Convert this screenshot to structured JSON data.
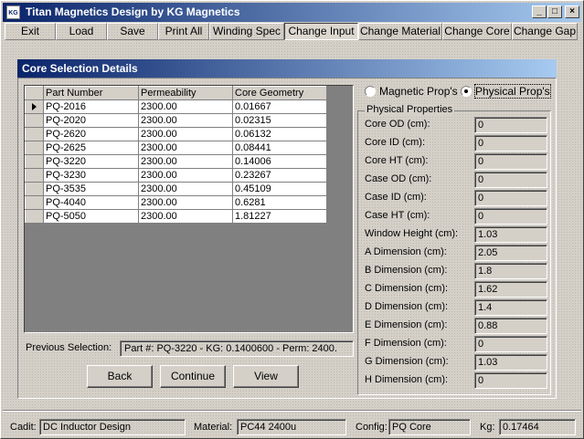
{
  "window": {
    "title": "Titan Magnetics Design by KG Magnetics",
    "icon_label": "KG",
    "minimize": "_",
    "maximize": "□",
    "close": "×"
  },
  "menu": [
    "Exit",
    "Load",
    "Save",
    "Print All",
    "Winding Spec",
    "Change Input",
    "Change Material",
    "Change Core",
    "Change Gap"
  ],
  "panel": {
    "title": "Core Selection Details"
  },
  "grid": {
    "columns": [
      "Part Number",
      "Permeability",
      "Core Geometry"
    ],
    "rows": [
      [
        "PQ-2016",
        "2300.00",
        "0.01667"
      ],
      [
        "PQ-2020",
        "2300.00",
        "0.02315"
      ],
      [
        "PQ-2620",
        "2300.00",
        "0.06132"
      ],
      [
        "PQ-2625",
        "2300.00",
        "0.08441"
      ],
      [
        "PQ-3220",
        "2300.00",
        "0.14006"
      ],
      [
        "PQ-3230",
        "2300.00",
        "0.23267"
      ],
      [
        "PQ-3535",
        "2300.00",
        "0.45109"
      ],
      [
        "PQ-4040",
        "2300.00",
        "0.6281"
      ],
      [
        "PQ-5050",
        "2300.00",
        "1.81227"
      ]
    ]
  },
  "props_mode": {
    "magnetic_label": "Magnetic Prop's",
    "physical_label": "Physical Prop's",
    "selected": "physical"
  },
  "physical": {
    "legend": "Physical Properties",
    "rows": [
      {
        "label": "Core OD (cm):",
        "value": "0"
      },
      {
        "label": "Core ID (cm):",
        "value": "0"
      },
      {
        "label": "Core HT (cm):",
        "value": "0"
      },
      {
        "label": "Case OD (cm):",
        "value": "0"
      },
      {
        "label": "Case ID (cm):",
        "value": "0"
      },
      {
        "label": "Case HT (cm):",
        "value": "0"
      },
      {
        "label": "Window Height (cm):",
        "value": "1.03"
      },
      {
        "label": "A Dimension (cm):",
        "value": "2.05"
      },
      {
        "label": "B Dimension (cm):",
        "value": "1.8"
      },
      {
        "label": "C Dimension (cm):",
        "value": "1.62"
      },
      {
        "label": "D Dimension (cm):",
        "value": "1.4"
      },
      {
        "label": "E Dimension (cm):",
        "value": "0.88"
      },
      {
        "label": "F Dimension (cm):",
        "value": "0"
      },
      {
        "label": "G Dimension (cm):",
        "value": "1.03"
      },
      {
        "label": "H Dimension (cm):",
        "value": "0"
      }
    ]
  },
  "previous": {
    "label": "Previous Selection:",
    "value": "Part #: PQ-3220 - KG: 0.1400600 - Perm: 2400."
  },
  "buttons": {
    "back": "Back",
    "continue": "Continue",
    "view": "View"
  },
  "status": {
    "cadit_label": "Cadit:",
    "cadit_value": "DC Inductor Design",
    "material_label": "Material:",
    "material_value": "PC44 2400u",
    "config_label": "Config:",
    "config_value": "PQ Core",
    "kg_label": "Kg:",
    "kg_value": "0.17464"
  }
}
